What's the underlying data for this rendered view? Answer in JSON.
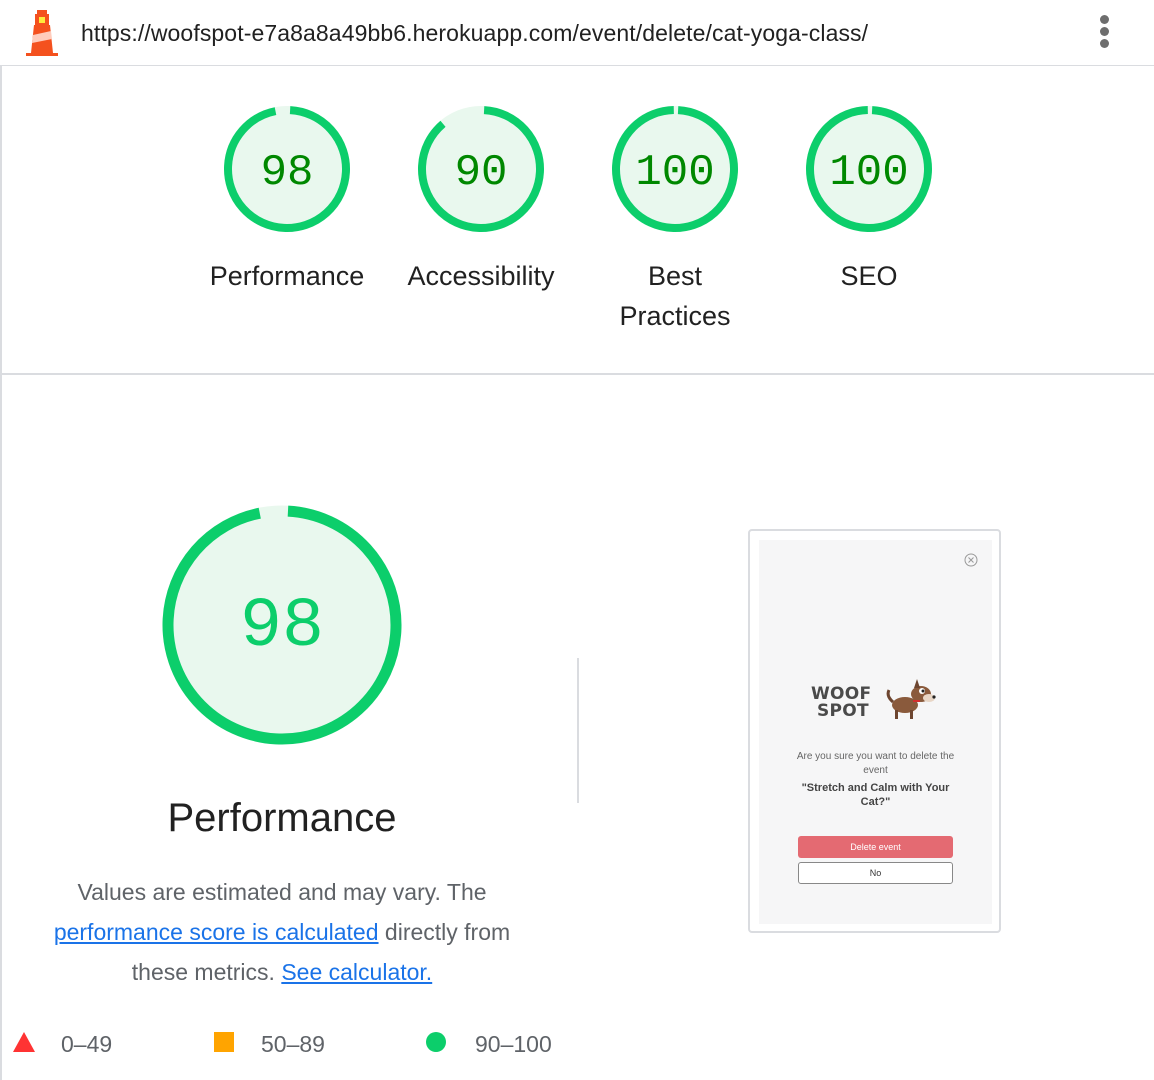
{
  "browser": {
    "url": "https://woofspot-e7a8a8a49bb6.herokuapp.com/event/delete/cat-yoga-class/",
    "menu_icon": "kebab-menu-icon",
    "logo_icon": "lighthouse-icon"
  },
  "colors": {
    "pass": "#0cce6b",
    "pass_text": "#008800",
    "pass_fill": "#e9f8ee",
    "average": "#ffa400",
    "fail": "#ff3333",
    "link": "#1a73e8"
  },
  "gauges": [
    {
      "score": "98",
      "label": "Performance",
      "value": 0.98
    },
    {
      "score": "90",
      "label": "Accessibility",
      "value": 0.9
    },
    {
      "score": "100",
      "label": "Best Practices",
      "label_line1": "Best",
      "label_line2": "Practices",
      "value": 1.0
    },
    {
      "score": "100",
      "label": "SEO",
      "value": 1.0
    }
  ],
  "performance": {
    "score": "98",
    "value": 0.98,
    "title": "Performance",
    "desc_prefix": "Values are estimated and may vary. The",
    "desc_link": "performance score is calculated",
    "desc_middle": "directly from these metrics.",
    "desc_middle_1": "directly from",
    "desc_middle_2": "these metrics.",
    "calculator_link": "See calculator."
  },
  "screenshot": {
    "close_icon": "close-icon",
    "brand_line1": "WOOF",
    "brand_line2": "SPOT",
    "dog_icon": "dog-mascot-icon",
    "question": "Are you sure you want to delete the event",
    "event_name": "\"Stretch and Calm with Your Cat?\"",
    "delete_button": "Delete event",
    "no_button": "No"
  },
  "legend": [
    {
      "range": "0–49",
      "shape": "triangle"
    },
    {
      "range": "50–89",
      "shape": "square"
    },
    {
      "range": "90–100",
      "shape": "circle"
    }
  ]
}
